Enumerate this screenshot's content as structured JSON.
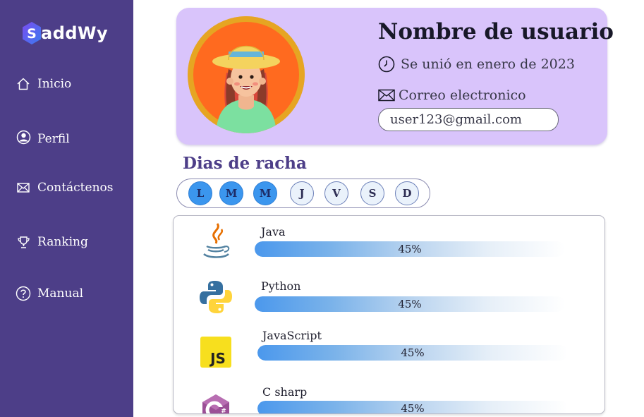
{
  "brand": {
    "name": "addWy",
    "badge_letter": "S"
  },
  "sidebar": {
    "items": [
      {
        "label": "Inicio",
        "icon": "home-icon"
      },
      {
        "label": "Perfil",
        "icon": "user-icon"
      },
      {
        "label": "Contáctenos",
        "icon": "mail-icon"
      },
      {
        "label": "Ranking",
        "icon": "trophy-icon"
      },
      {
        "label": "Manual",
        "icon": "help-icon"
      }
    ]
  },
  "profile": {
    "username": "Nombre de usuario",
    "joined": "Se unió en enero de 2023",
    "email_label": "Correo electronico",
    "email_value": "user123@gmail.com"
  },
  "streak": {
    "title": "Dias de racha",
    "days": [
      {
        "label": "L",
        "active": true
      },
      {
        "label": "M",
        "active": true
      },
      {
        "label": "M",
        "active": true
      },
      {
        "label": "J",
        "active": false
      },
      {
        "label": "V",
        "active": false
      },
      {
        "label": "S",
        "active": false
      },
      {
        "label": "D",
        "active": false
      }
    ]
  },
  "languages": [
    {
      "name": "Java",
      "icon": "java-icon",
      "progress_label": "45%"
    },
    {
      "name": "Python",
      "icon": "python-icon",
      "progress_label": "45%"
    },
    {
      "name": "JavaScript",
      "icon": "javascript-icon",
      "progress_label": "45%"
    },
    {
      "name": "C sharp",
      "icon": "csharp-icon",
      "progress_label": "45%"
    }
  ],
  "colors": {
    "sidebar": "#4d3e88",
    "card": "#d9c4fb",
    "accent": "#3b96ee"
  }
}
